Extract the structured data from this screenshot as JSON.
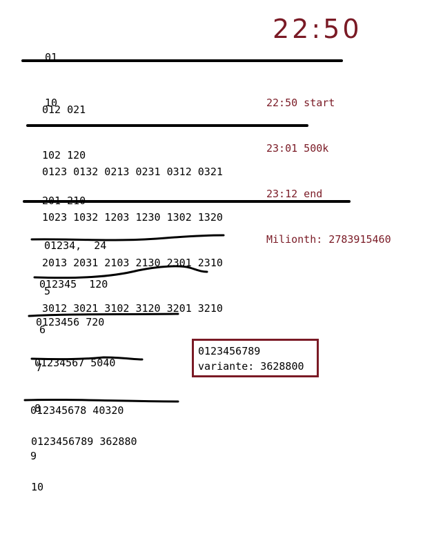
{
  "blocks": {
    "b2": [
      "01",
      "10"
    ],
    "b3": [
      "012 021",
      "102 120",
      "201 210"
    ],
    "b4": [
      "0123 0132 0213 0231 0312 0321",
      "1023 1032 1203 1230 1302 1320",
      "2013 2031 2103 2130 2301 2310",
      "3012 3021 3102 3120 3201 3210"
    ],
    "b5": [
      "01234,  24",
      "5"
    ],
    "b6": [
      "012345  120",
      "6"
    ],
    "b7": [
      "0123456 720",
      "7"
    ],
    "b8": [
      "01234567 5040",
      "8"
    ],
    "b9": [
      "012345678 40320",
      "9"
    ],
    "b10": [
      "0123456789 362880",
      "10"
    ]
  },
  "time_big": "22:50",
  "log": [
    "22:50 start",
    "23:01 500k",
    "23:12 end",
    "Milionth: 2783915460"
  ],
  "box": {
    "line1": "0123456789",
    "line2": "variante: 3628800"
  },
  "colors": {
    "accent": "#7a1a25",
    "ink": "#000000"
  }
}
